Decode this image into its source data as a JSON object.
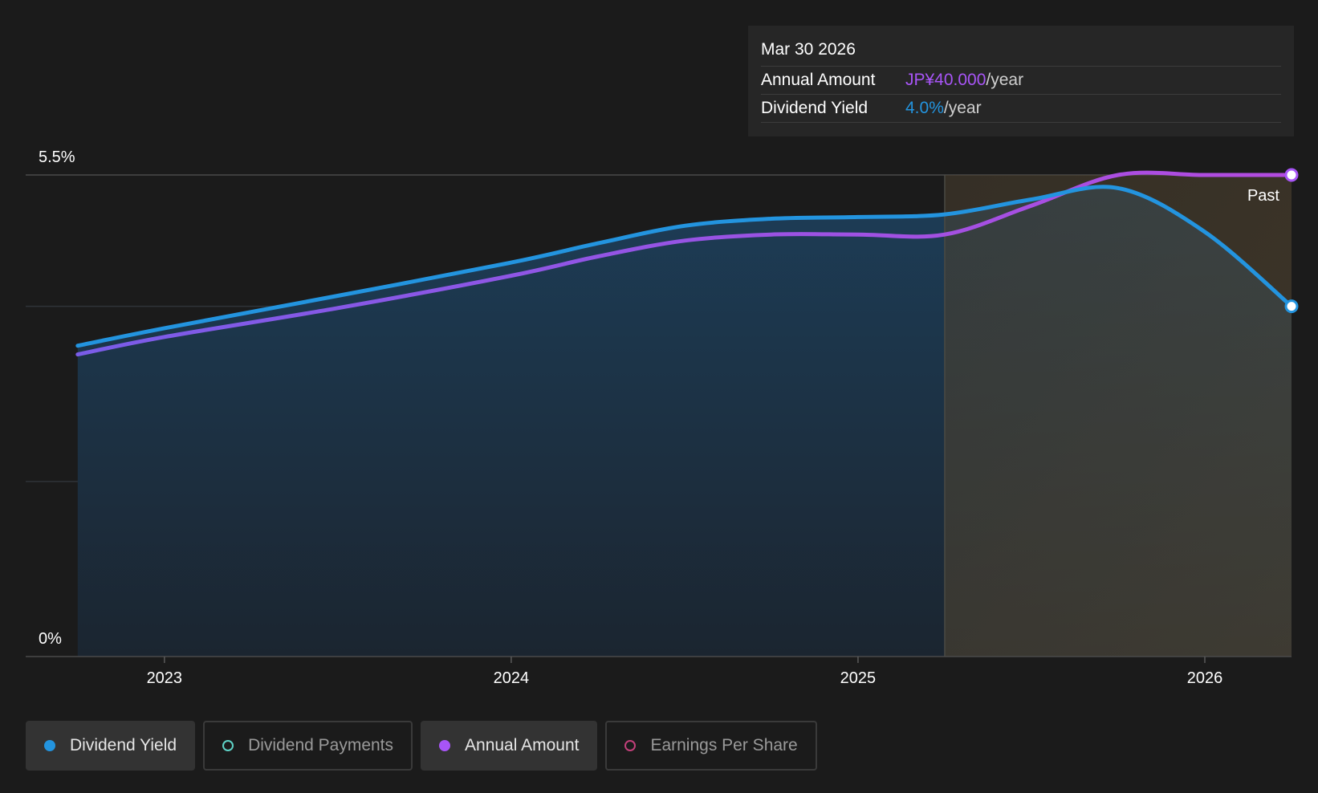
{
  "chart_data": {
    "type": "area",
    "y_axis": {
      "min_label": "0%",
      "max_label": "5.5%",
      "ylim": [
        0,
        5.5
      ]
    },
    "x_axis": {
      "tick_labels": [
        "2023",
        "2024",
        "2025",
        "2026"
      ],
      "ticks": [
        2023.0,
        2024.0,
        2025.0,
        2026.0
      ],
      "xlim": [
        2022.6,
        2026.25
      ]
    },
    "past_marker": {
      "label": "Past",
      "x_start": 2025.25
    },
    "series": [
      {
        "name": "Dividend Yield",
        "color": "#2394df",
        "x": [
          2022.75,
          2023.0,
          2023.5,
          2024.0,
          2024.25,
          2024.5,
          2024.75,
          2025.0,
          2025.25,
          2025.5,
          2025.75,
          2026.0,
          2026.25
        ],
        "y": [
          3.55,
          3.75,
          4.12,
          4.5,
          4.72,
          4.92,
          5.0,
          5.02,
          5.05,
          5.22,
          5.35,
          4.85,
          4.0
        ]
      },
      {
        "name": "Annual Amount",
        "color": "#9b5cf0",
        "x": [
          2022.75,
          2023.0,
          2023.5,
          2024.0,
          2024.25,
          2024.5,
          2024.75,
          2025.0,
          2025.25,
          2025.5,
          2025.75,
          2026.0,
          2026.25
        ],
        "y": [
          3.45,
          3.65,
          3.98,
          4.35,
          4.57,
          4.75,
          4.82,
          4.82,
          4.82,
          5.15,
          5.5,
          5.5,
          5.5
        ]
      }
    ]
  },
  "tooltip": {
    "date": "Mar 30 2026",
    "rows": [
      {
        "label": "Annual Amount",
        "value": "JP¥40.000",
        "unit": "/year",
        "color": "#a855f7"
      },
      {
        "label": "Dividend Yield",
        "value": "4.0%",
        "unit": "/year",
        "color": "#2394df"
      }
    ]
  },
  "legend": [
    {
      "label": "Dividend Yield",
      "active": true,
      "color": "#2394df",
      "filled": true
    },
    {
      "label": "Dividend Payments",
      "active": false,
      "color": "#5fd3c7",
      "filled": false
    },
    {
      "label": "Annual Amount",
      "active": true,
      "color": "#a855f7",
      "filled": true
    },
    {
      "label": "Earnings Per Share",
      "active": false,
      "color": "#c2407a",
      "filled": false
    }
  ]
}
